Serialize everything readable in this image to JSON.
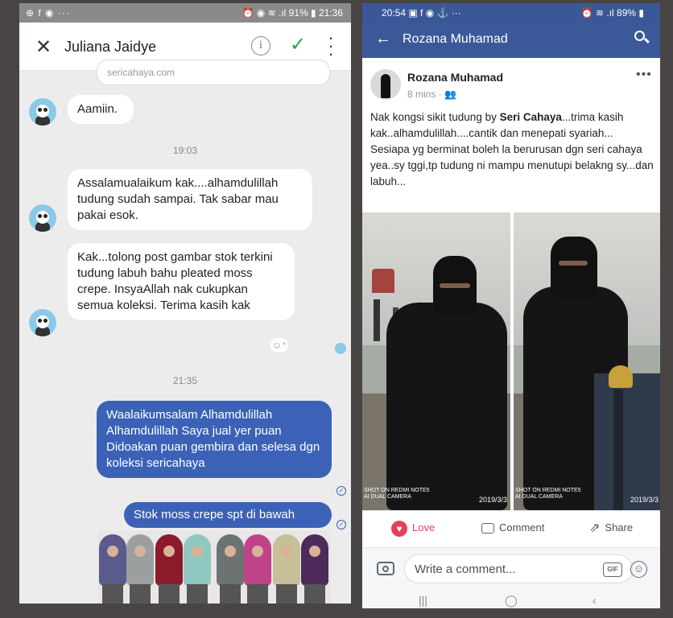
{
  "left": {
    "status": {
      "left_icons": "⊕ f ◉ ···",
      "right_text": "⏰ ◉ ≋ .ıl 91% ▮ 21:36"
    },
    "contact_name": "Juliana Jaidye",
    "link_preview": "sericahaya.com",
    "messages": [
      {
        "type": "in",
        "text": "Aamiin."
      },
      {
        "type": "time",
        "text": "19:03"
      },
      {
        "type": "in",
        "text": "Assalamualaikum kak....alhamdulillah tudung sudah sampai. Tak sabar mau pakai esok."
      },
      {
        "type": "in",
        "text": "Kak...tolong post gambar stok terkini tudung labuh bahu pleated moss crepe. InsyaAllah nak cukupkan semua koleksi. Terima kasih kak"
      },
      {
        "type": "time",
        "text": "21:35"
      },
      {
        "type": "out",
        "text": "Waalaikumsalam Alhamdulillah Alhamdulillah Saya jual yer puan Didoakan puan gembira dan selesa dgn koleksi sericahaya"
      },
      {
        "type": "out",
        "text": "Stok moss crepe spt di bawah"
      }
    ],
    "stock_colors": [
      "#5a5a8c",
      "#9b9fa0",
      "#8b1a2b",
      "#8fc8c0",
      "#6d7273",
      "#c0438a",
      "#c7bf9a",
      "#4d2a5a"
    ]
  },
  "right": {
    "status": {
      "left_text": "20:54 ▣ f ◉ ⚓ ···",
      "right_text": "⏰ ≋ .ıl 89% ▮"
    },
    "page_title": "Rozana Muhamad",
    "post": {
      "author": "Rozana Muhamad",
      "meta": "8 mins · 👥",
      "text_before": "Nak kongsi sikit tudung by ",
      "text_bold": "Seri Cahaya",
      "text_after": "...trima kasih kak..alhamdulillah....cantik dan menepati syariah...\nSesiapa yg berminat boleh la berurusan dgn seri cahaya yea..sy tggi,tp tudung ni mampu menutupi belakng sy...dan labuh...",
      "photos": [
        {
          "watermark": "SHOT ON REDMI NOTE5\nAI DUAL CAMERA",
          "date": "2019/3/3"
        },
        {
          "watermark": "SHOT ON REDMI NOTE5\nAI DUAL CAMERA",
          "date": "2019/3/3"
        }
      ]
    },
    "actions": {
      "love": "Love",
      "comment": "Comment",
      "share": "Share"
    },
    "comment_placeholder": "Write a comment...",
    "gif_label": "GIF",
    "nav": {
      "recent": "|||",
      "home": "◯",
      "back": "‹"
    }
  }
}
